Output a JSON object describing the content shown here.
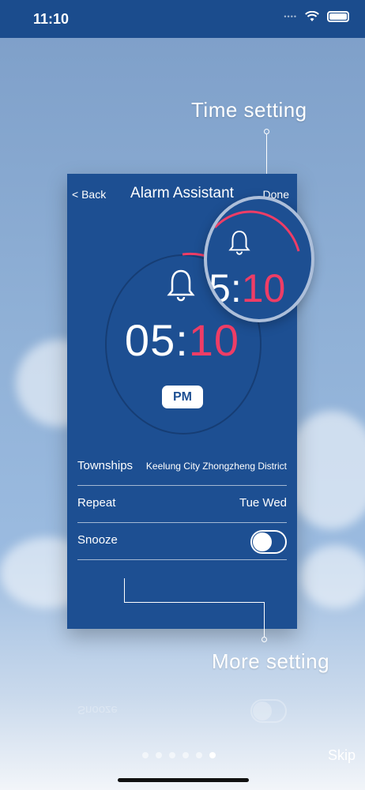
{
  "status_bar": {
    "time": "11:10",
    "signal": "••••"
  },
  "callouts": {
    "top": "Time setting",
    "bottom": "More setting"
  },
  "nav": {
    "back": "< Back",
    "title": "Alarm Assistant",
    "done": "Done"
  },
  "alarm": {
    "hour": "05",
    "separator": ":",
    "minute": "10",
    "period": "PM"
  },
  "magnifier": {
    "hour_fragment": "5",
    "separator": ":",
    "minute": "10"
  },
  "settings": [
    {
      "label": "Townships",
      "value": "Keelung City Zhongzheng District"
    },
    {
      "label": "Repeat",
      "value": "Tue Wed"
    },
    {
      "label": "Snooze",
      "toggle_on": false
    }
  ],
  "reflection": {
    "snooze_label": "Snooze"
  },
  "pagination": {
    "total": 6,
    "active_index": 5
  },
  "skip": "Skip",
  "colors": {
    "panel": "#1d4f92",
    "accent": "#ee3d66",
    "status_bar": "#1b4c8d"
  },
  "icons": [
    "wifi-icon",
    "battery-icon",
    "bell-icon"
  ]
}
